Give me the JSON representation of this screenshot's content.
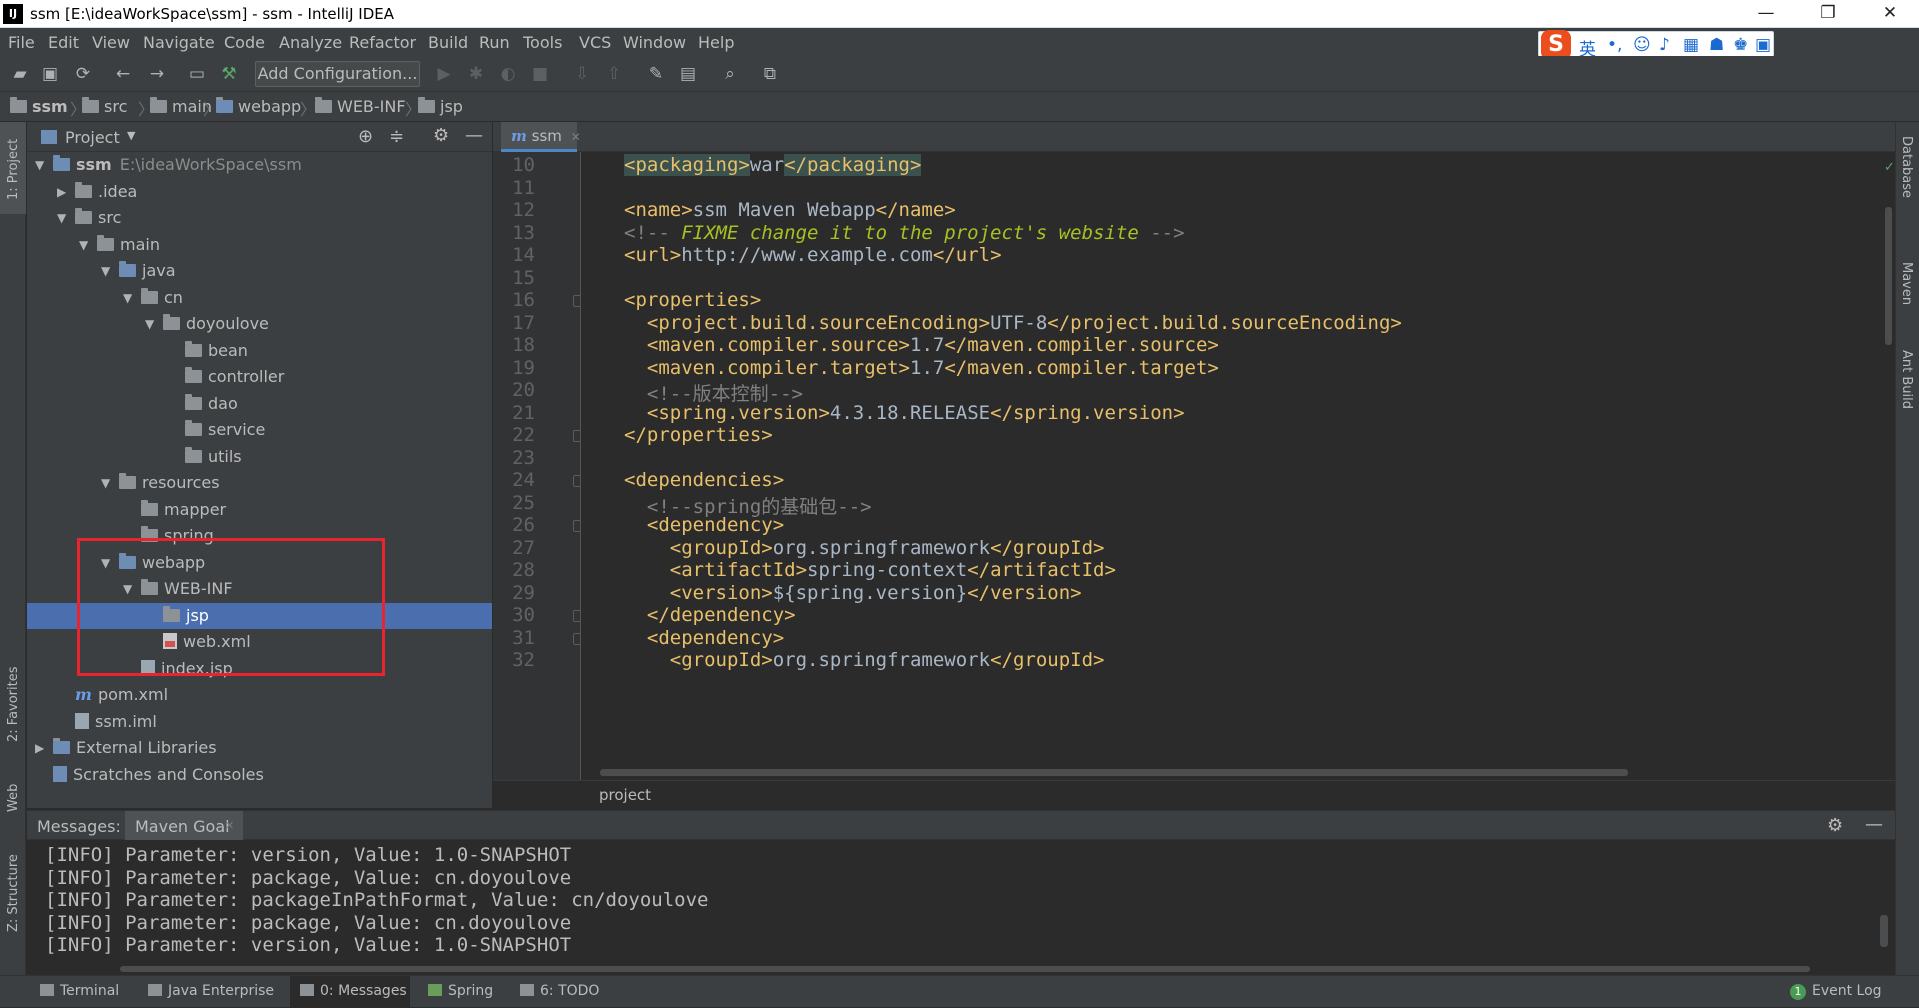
{
  "window": {
    "title": "ssm [E:\\ideaWorkSpace\\ssm] - ssm - IntelliJ IDEA",
    "logo": "IJ",
    "minimize_glyph": "—",
    "restore_glyph": "❐",
    "close_glyph": "✕"
  },
  "menu": [
    "File",
    "Edit",
    "View",
    "Navigate",
    "Code",
    "Analyze",
    "Refactor",
    "Build",
    "Run",
    "Tools",
    "VCS",
    "Window",
    "Help"
  ],
  "ime": {
    "logo": "S",
    "mode": "英"
  },
  "toolbar": {
    "add_configuration": "Add Configuration..."
  },
  "breadcrumb": [
    "ssm",
    "src",
    "main",
    "webapp",
    "WEB-INF",
    "jsp"
  ],
  "left_stripe": {
    "project": "1: Project",
    "favorites": "2: Favorites",
    "web": "Web",
    "structure": "Z: Structure"
  },
  "right_stripe": {
    "database": "Database",
    "maven": "Maven",
    "ant": "Ant Build"
  },
  "project_panel": {
    "title": "Project",
    "tree": [
      {
        "label": "ssm",
        "hint": "E:\\ideaWorkSpace\\ssm",
        "depth": 0,
        "arrow": "▼",
        "icon": "folder-module"
      },
      {
        "label": ".idea",
        "depth": 1,
        "arrow": "▶",
        "icon": "folder"
      },
      {
        "label": "src",
        "depth": 1,
        "arrow": "▼",
        "icon": "folder"
      },
      {
        "label": "main",
        "depth": 2,
        "arrow": "▼",
        "icon": "folder"
      },
      {
        "label": "java",
        "depth": 3,
        "arrow": "▼",
        "icon": "folder-blue"
      },
      {
        "label": "cn",
        "depth": 4,
        "arrow": "▼",
        "icon": "folder-package"
      },
      {
        "label": "doyoulove",
        "depth": 5,
        "arrow": "▼",
        "icon": "folder-package"
      },
      {
        "label": "bean",
        "depth": 6,
        "arrow": "",
        "icon": "folder-package"
      },
      {
        "label": "controller",
        "depth": 6,
        "arrow": "",
        "icon": "folder-package"
      },
      {
        "label": "dao",
        "depth": 6,
        "arrow": "",
        "icon": "folder-package"
      },
      {
        "label": "service",
        "depth": 6,
        "arrow": "",
        "icon": "folder-package"
      },
      {
        "label": "utils",
        "depth": 6,
        "arrow": "",
        "icon": "folder-package"
      },
      {
        "label": "resources",
        "depth": 3,
        "arrow": "▼",
        "icon": "folder-resources"
      },
      {
        "label": "mapper",
        "depth": 4,
        "arrow": "",
        "icon": "folder"
      },
      {
        "label": "spring",
        "depth": 4,
        "arrow": "",
        "icon": "folder"
      },
      {
        "label": "webapp",
        "depth": 3,
        "arrow": "▼",
        "icon": "folder-web"
      },
      {
        "label": "WEB-INF",
        "depth": 4,
        "arrow": "▼",
        "icon": "folder"
      },
      {
        "label": "jsp",
        "depth": 5,
        "arrow": "",
        "icon": "folder",
        "selected": true
      },
      {
        "label": "web.xml",
        "depth": 5,
        "arrow": "",
        "icon": "file-xml"
      },
      {
        "label": "index.jsp",
        "depth": 4,
        "arrow": "",
        "icon": "file-jsp"
      },
      {
        "label": "pom.xml",
        "depth": 1,
        "arrow": "",
        "icon": "file-maven"
      },
      {
        "label": "ssm.iml",
        "depth": 1,
        "arrow": "",
        "icon": "file-iml"
      },
      {
        "label": "External Libraries",
        "depth": 0,
        "arrow": "▶",
        "icon": "libraries"
      },
      {
        "label": "Scratches and Consoles",
        "depth": 0,
        "arrow": "",
        "icon": "scratches"
      }
    ]
  },
  "editor": {
    "tab": "ssm",
    "tab_icon": "m",
    "breadcrumb": "project",
    "lines": [
      {
        "n": "10",
        "text": "<packaging>war</packaging>"
      },
      {
        "n": "11",
        "text": ""
      },
      {
        "n": "12",
        "text": "<name>ssm Maven Webapp</name>"
      },
      {
        "n": "13",
        "text": "<!-- FIXME change it to the project's website -->"
      },
      {
        "n": "14",
        "text": "<url>http://www.example.com</url>"
      },
      {
        "n": "15",
        "text": ""
      },
      {
        "n": "16",
        "text": "<properties>"
      },
      {
        "n": "17",
        "text": "  <project.build.sourceEncoding>UTF-8</project.build.sourceEncoding>"
      },
      {
        "n": "18",
        "text": "  <maven.compiler.source>1.7</maven.compiler.source>"
      },
      {
        "n": "19",
        "text": "  <maven.compiler.target>1.7</maven.compiler.target>"
      },
      {
        "n": "20",
        "text": "  <!--版本控制-->"
      },
      {
        "n": "21",
        "text": "  <spring.version>4.3.18.RELEASE</spring.version>"
      },
      {
        "n": "22",
        "text": "</properties>"
      },
      {
        "n": "23",
        "text": ""
      },
      {
        "n": "24",
        "text": "<dependencies>"
      },
      {
        "n": "25",
        "text": "  <!--spring的基础包-->"
      },
      {
        "n": "26",
        "text": "  <dependency>"
      },
      {
        "n": "27",
        "text": "    <groupId>org.springframework</groupId>"
      },
      {
        "n": "28",
        "text": "    <artifactId>spring-context</artifactId>"
      },
      {
        "n": "29",
        "text": "    <version>${spring.version}</version>"
      },
      {
        "n": "30",
        "text": "  </dependency>"
      },
      {
        "n": "31",
        "text": "  <dependency>"
      },
      {
        "n": "32",
        "text": "    <groupId>org.springframework</groupId>"
      }
    ]
  },
  "messages": {
    "label": "Messages:",
    "tab": "Maven Goal",
    "lines": [
      "[INFO] Parameter: version, Value: 1.0-SNAPSHOT",
      "[INFO] Parameter: package, Value: cn.doyoulove",
      "[INFO] Parameter: packageInPathFormat, Value: cn/doyoulove",
      "[INFO] Parameter: package, Value: cn.doyoulove",
      "[INFO] Parameter: version, Value: 1.0-SNAPSHOT"
    ]
  },
  "statusbar": {
    "items": [
      "Terminal",
      "Java Enterprise",
      "0: Messages",
      "Spring",
      "6: TODO"
    ],
    "event_log": "Event Log",
    "event_count": "1"
  },
  "colors": {
    "accent": "#4b6eaf",
    "highlight_box": "#e8242e",
    "xml_tag": "#e8bf6a",
    "comment": "#808080",
    "todo": "#a8c023"
  }
}
